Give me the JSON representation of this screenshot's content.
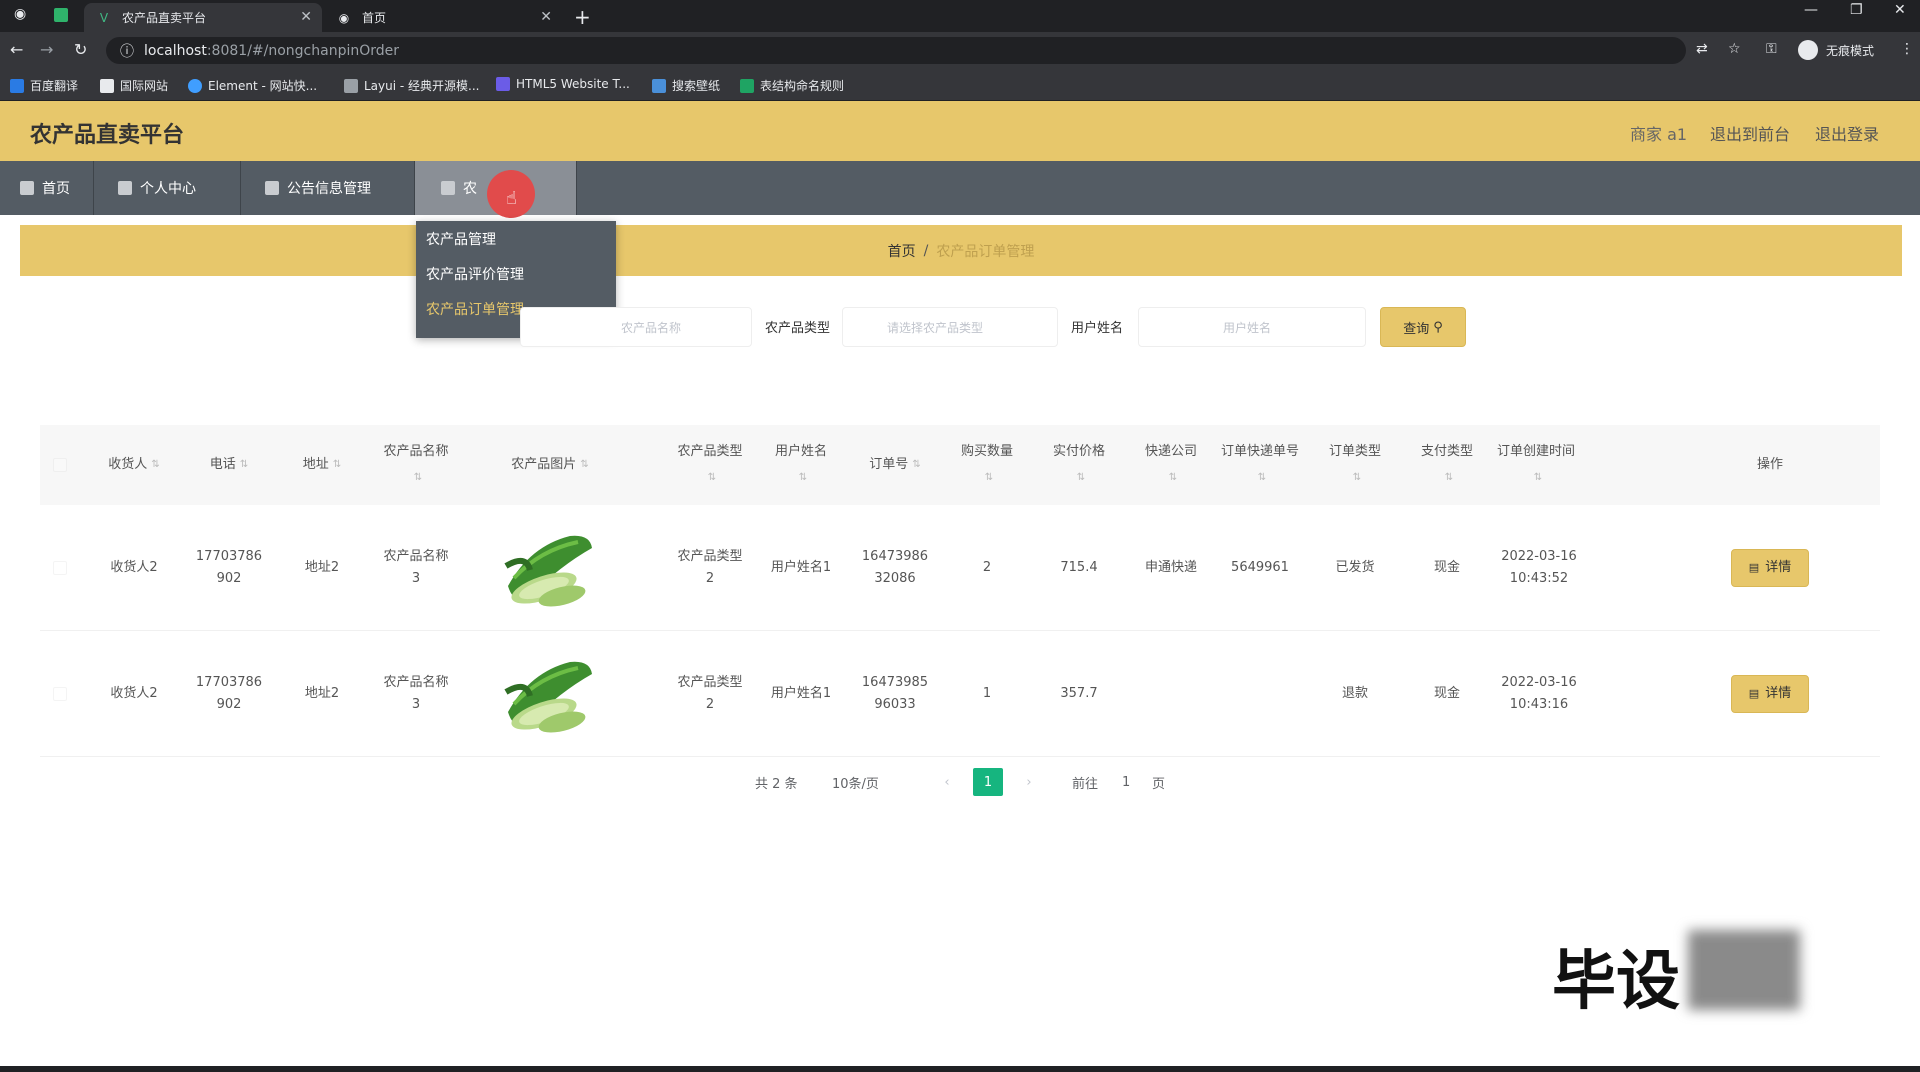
{
  "browser": {
    "tabs": [
      {
        "title": "农产品直卖平台",
        "active": true
      },
      {
        "title": "首页",
        "active": false
      }
    ],
    "url_host": "localhost",
    "url_path": ":8081/#/nongchanpinOrder",
    "profile_label": "无痕模式",
    "bookmarks": [
      "百度翻译",
      "国际网站",
      "Element - 网站快...",
      "Layui - 经典开源模...",
      "HTML5 Website T...",
      "搜索壁纸",
      "表结构命名规则"
    ]
  },
  "header": {
    "title": "农产品直卖平台",
    "user": "商家 a1",
    "to_front": "退出到前台",
    "logout": "退出登录"
  },
  "nav": {
    "items": [
      "首页",
      "个人中心",
      "公告信息管理",
      "农"
    ]
  },
  "dropdown": {
    "items": [
      "农产品管理",
      "农产品评价管理",
      "农产品订单管理"
    ]
  },
  "breadcrumb": {
    "home": "首页",
    "sep": "/",
    "current": "农产品订单管理"
  },
  "search": {
    "field1_placeholder": "农产品名称",
    "type_label": "农产品类型",
    "type_placeholder": "请选择农产品类型",
    "user_label": "用户姓名",
    "user_placeholder": "用户姓名",
    "button": "查询"
  },
  "table": {
    "headers": [
      "收货人",
      "电话",
      "地址",
      "农产品名称",
      "农产品图片",
      "农产品类型",
      "用户姓名",
      "订单号",
      "购买数量",
      "实付价格",
      "快递公司",
      "订单快递单号",
      "订单类型",
      "支付类型",
      "订单创建时间",
      "操作"
    ],
    "rows": [
      {
        "consignee": "收货人2",
        "phone": "17703786902",
        "address": "地址2",
        "product": "农产品名称3",
        "type": "农产品类型2",
        "user": "用户姓名1",
        "order_no": "1647398632086",
        "qty": "2",
        "price": "715.4",
        "courier": "申通快递",
        "tracking": "5649961",
        "order_type": "已发货",
        "pay_type": "现金",
        "created": "2022-03-16 10:43:52",
        "action": "详情"
      },
      {
        "consignee": "收货人2",
        "phone": "17703786902",
        "address": "地址2",
        "product": "农产品名称3",
        "type": "农产品类型2",
        "user": "用户姓名1",
        "order_no": "1647398596033",
        "qty": "1",
        "price": "357.7",
        "courier": "",
        "tracking": "",
        "order_type": "退款",
        "pay_type": "现金",
        "created": "2022-03-16 10:43:16",
        "action": "详情"
      }
    ]
  },
  "pagination": {
    "total": "共 2 条",
    "page_size": "10条/页",
    "prev": "‹",
    "current": "1",
    "next": "›",
    "goto": "前往",
    "goto_value": "1",
    "page_suffix": "页"
  },
  "watermark": {
    "text": "毕设"
  }
}
